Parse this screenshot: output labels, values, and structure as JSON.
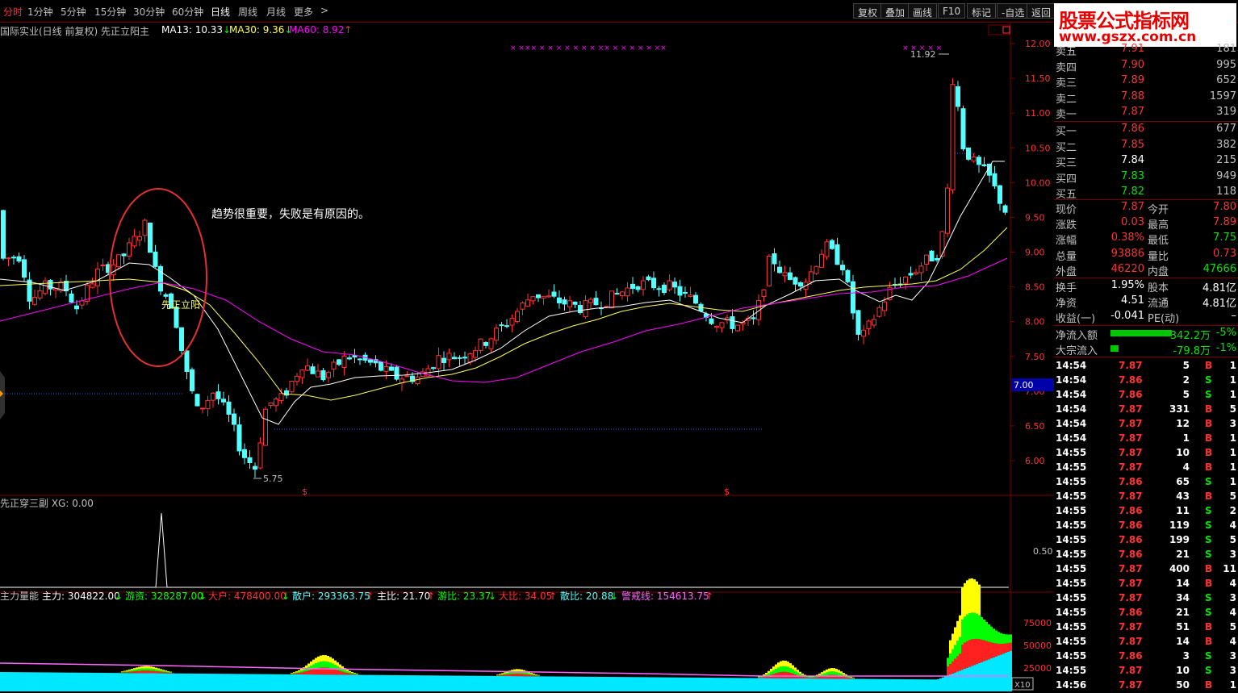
{
  "toolbar": {
    "periods": [
      "分时",
      "1分钟",
      "5分钟",
      "15分钟",
      "30分钟",
      "60分钟",
      "日线",
      "周线",
      "月线",
      "更多"
    ],
    "more_arrow": ">",
    "buttons": [
      "复权",
      "叠加",
      "画线",
      "F10",
      "标记",
      "-自选",
      "返回"
    ]
  },
  "logo": {
    "name": "股票公式指标网",
    "url": "www.gszx.com.cn"
  },
  "main_chart": {
    "stock_title": "国际实业(日线 前复权) 先正立阳主",
    "ma13": "MA13: 10.33",
    "ma30": "MA30: 9.36",
    "ma60": "MA60: 8.92",
    "arrow_down": "↓",
    "arrow_up": "↑",
    "annotation": "趋势很重要，失败是有原因的。",
    "signal_label": "先正立阳",
    "high_label": "11.92",
    "low_label": "5.75",
    "price_ticks": [
      "12.00",
      "11.50",
      "11.00",
      "10.50",
      "10.00",
      "9.50",
      "9.00",
      "8.50",
      "8.00",
      "7.50",
      "7.00",
      "6.50",
      "6.00"
    ],
    "current_price_tag": "7.00",
    "marker_s": "$",
    "x_markers": "× ××× × × × × × × × ×× × × × × × ××"
  },
  "sub1": {
    "title": "先正穿三副  XG: 0.00",
    "tick": "0.50"
  },
  "sub2": {
    "title": "主力量能",
    "zhuli": "主力: 304822.00",
    "youzi": "游资: 328287.00",
    "dahu": "大户: 478400.00",
    "sanhu": "散户: 293363.75",
    "zhubi": "主比: 21.70",
    "youbi": "游比: 23.37",
    "dabi": "大比: 34.05",
    "sanbi": "散比: 20.88",
    "jingjie": "警戒线: 154613.75",
    "ticks": [
      "75000",
      "50000",
      "25000"
    ],
    "unit": "X10"
  },
  "orderbook": {
    "asks": [
      {
        "label": "卖五",
        "price": "7.91",
        "vol": "181"
      },
      {
        "label": "卖四",
        "price": "7.90",
        "vol": "995"
      },
      {
        "label": "卖三",
        "price": "7.89",
        "vol": "652"
      },
      {
        "label": "卖二",
        "price": "7.88",
        "vol": "1597"
      },
      {
        "label": "卖一",
        "price": "7.87",
        "vol": "319"
      }
    ],
    "bids": [
      {
        "label": "买一",
        "price": "7.86",
        "vol": "677"
      },
      {
        "label": "买二",
        "price": "7.85",
        "vol": "382"
      },
      {
        "label": "买三",
        "price": "7.84",
        "vol": "215"
      },
      {
        "label": "买四",
        "price": "7.83",
        "vol": "949"
      },
      {
        "label": "买五",
        "price": "7.82",
        "vol": "118"
      }
    ]
  },
  "quote": [
    {
      "l1": "现价",
      "v1": "7.87",
      "l2": "今开",
      "v2": "7.80"
    },
    {
      "l1": "涨跌",
      "v1": "0.03",
      "l2": "最高",
      "v2": "7.89"
    },
    {
      "l1": "涨幅",
      "v1": "0.38%",
      "l2": "最低",
      "v2": "7.75"
    },
    {
      "l1": "总量",
      "v1": "93886",
      "l2": "量比",
      "v2": "0.73"
    },
    {
      "l1": "外盘",
      "v1": "46220",
      "l2": "内盘",
      "v2": "47666"
    }
  ],
  "fundamentals": [
    {
      "l1": "换手",
      "v1": "1.95%",
      "l2": "股本",
      "v2": "4.81亿"
    },
    {
      "l1": "净资",
      "v1": "4.51",
      "l2": "流通",
      "v2": "4.81亿"
    },
    {
      "l1": "收益(一)",
      "v1": "-0.041",
      "l2": "PE(动)",
      "v2": "–"
    }
  ],
  "flows": [
    {
      "label": "净流入额",
      "value": "-342.2万",
      "pct": "-5%"
    },
    {
      "label": "大宗流入",
      "value": "-79.8万",
      "pct": "-1%"
    }
  ],
  "ticks": [
    {
      "t": "14:54",
      "p": "7.87",
      "v": "5",
      "d": "B",
      "n": "1"
    },
    {
      "t": "14:54",
      "p": "7.86",
      "v": "2",
      "d": "S",
      "n": "1"
    },
    {
      "t": "14:54",
      "p": "7.86",
      "v": "5",
      "d": "S",
      "n": "1"
    },
    {
      "t": "14:54",
      "p": "7.87",
      "v": "331",
      "d": "B",
      "n": "5"
    },
    {
      "t": "14:54",
      "p": "7.87",
      "v": "12",
      "d": "B",
      "n": "3"
    },
    {
      "t": "14:54",
      "p": "7.87",
      "v": "1",
      "d": "B",
      "n": "1"
    },
    {
      "t": "14:55",
      "p": "7.87",
      "v": "10",
      "d": "B",
      "n": "1"
    },
    {
      "t": "14:55",
      "p": "7.87",
      "v": "4",
      "d": "B",
      "n": "1"
    },
    {
      "t": "14:55",
      "p": "7.86",
      "v": "65",
      "d": "S",
      "n": "1"
    },
    {
      "t": "14:55",
      "p": "7.87",
      "v": "43",
      "d": "B",
      "n": "5"
    },
    {
      "t": "14:55",
      "p": "7.86",
      "v": "11",
      "d": "S",
      "n": "2"
    },
    {
      "t": "14:55",
      "p": "7.86",
      "v": "119",
      "d": "S",
      "n": "4"
    },
    {
      "t": "14:55",
      "p": "7.86",
      "v": "199",
      "d": "S",
      "n": "5"
    },
    {
      "t": "14:55",
      "p": "7.86",
      "v": "21",
      "d": "S",
      "n": "3"
    },
    {
      "t": "14:55",
      "p": "7.87",
      "v": "400",
      "d": "B",
      "n": "11"
    },
    {
      "t": "14:55",
      "p": "7.87",
      "v": "14",
      "d": "B",
      "n": "4"
    },
    {
      "t": "14:55",
      "p": "7.87",
      "v": "34",
      "d": "S",
      "n": "3"
    },
    {
      "t": "14:55",
      "p": "7.86",
      "v": "21",
      "d": "S",
      "n": "4"
    },
    {
      "t": "14:55",
      "p": "7.87",
      "v": "51",
      "d": "B",
      "n": "5"
    },
    {
      "t": "14:55",
      "p": "7.87",
      "v": "14",
      "d": "B",
      "n": "4"
    },
    {
      "t": "14:55",
      "p": "7.86",
      "v": "3",
      "d": "S",
      "n": "3"
    },
    {
      "t": "14:55",
      "p": "7.87",
      "v": "10",
      "d": "S",
      "n": "3"
    },
    {
      "t": "14:56",
      "p": "7.87",
      "v": "50",
      "d": "B",
      "n": "1"
    }
  ],
  "colors": {
    "up": "#ff3232",
    "down": "#54ffff",
    "ma13": "#ffffff",
    "ma30": "#ffff54",
    "ma60": "#ff00ff",
    "border": "#7a0000"
  }
}
